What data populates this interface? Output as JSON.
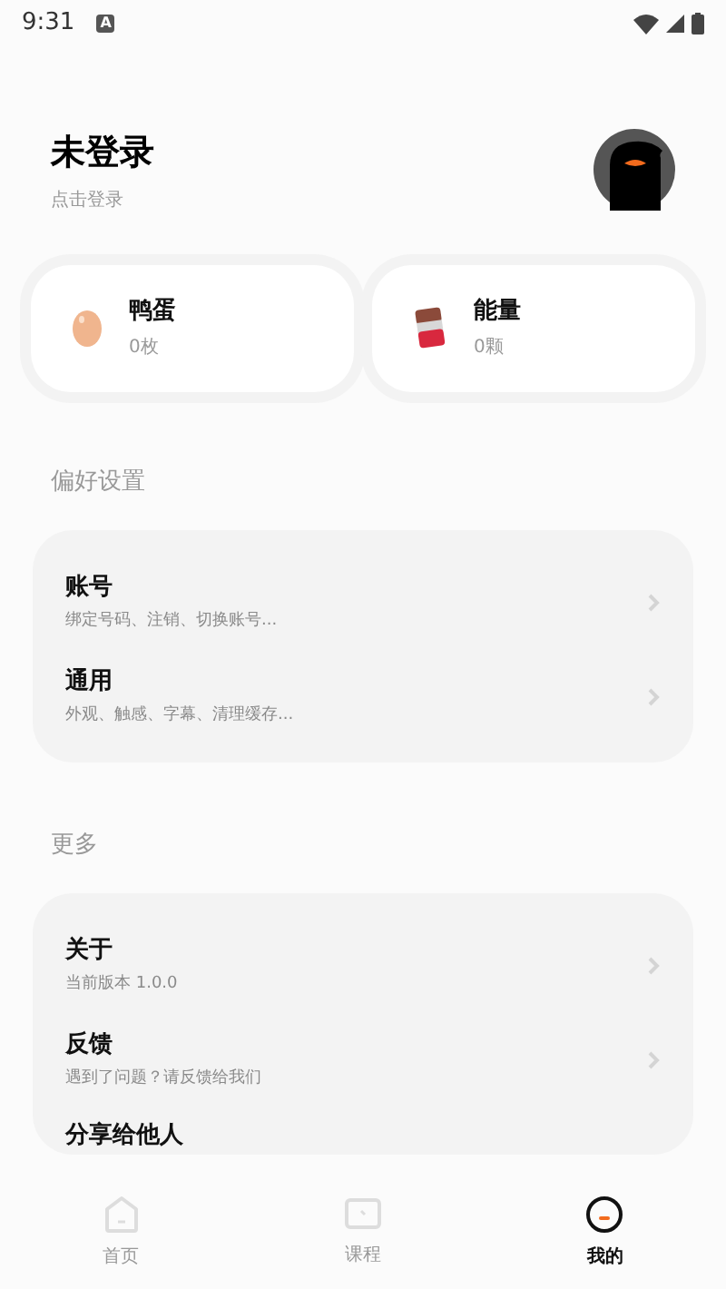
{
  "status_bar": {
    "time": "9:31",
    "notice": "A"
  },
  "profile": {
    "name": "未登录",
    "hint": "点击登录"
  },
  "stats": [
    {
      "kind": "egg",
      "title": "鸭蛋",
      "value": "0枚"
    },
    {
      "kind": "energy",
      "title": "能量",
      "value": "0颗"
    }
  ],
  "sections": [
    {
      "title": "偏好设置",
      "items": [
        {
          "title": "账号",
          "subtitle": "绑定号码、注销、切换账号..."
        },
        {
          "title": "通用",
          "subtitle": "外观、触感、字幕、清理缓存..."
        }
      ]
    },
    {
      "title": "更多",
      "items": [
        {
          "title": "关于",
          "subtitle": "当前版本 1.0.0"
        },
        {
          "title": "反馈",
          "subtitle": "遇到了问题？请反馈给我们"
        },
        {
          "title": "分享给他人"
        }
      ]
    }
  ],
  "nav": [
    {
      "kind": "home",
      "label": "首页",
      "selected": false
    },
    {
      "kind": "course",
      "label": "课程",
      "selected": false
    },
    {
      "kind": "me",
      "label": "我的",
      "selected": true
    }
  ]
}
